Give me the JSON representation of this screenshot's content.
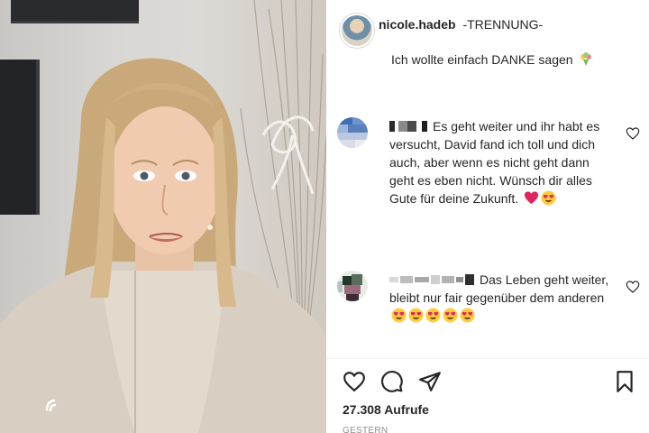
{
  "post": {
    "username": "nicole.hadeb",
    "caption_title": "-TRENNUNG-",
    "caption_body": "Ich wollte einfach DANKE sagen",
    "views": "27.308 Aufrufe",
    "timestamp": "GESTERN"
  },
  "comments": [
    {
      "text": "Es geht weiter und ihr habt es versucht, David fand ich toll und dich auch, aber wenn es nicht geht dann geht es eben nicht. Wünsch dir alles Gute für deine Zukunft.",
      "emojis": [
        "red-heart",
        "heart-eyes"
      ]
    },
    {
      "text": "Das Leben geht weiter, bleibt nur fair gegenüber dem anderen",
      "emojis": [
        "heart-eyes",
        "heart-eyes",
        "heart-eyes",
        "heart-eyes",
        "heart-eyes"
      ]
    }
  ],
  "actions": [
    "like-icon",
    "comment-icon",
    "share-icon",
    "save-icon"
  ],
  "colors": {
    "text": "#262626",
    "muted": "#8e8e8e",
    "heart_red": "#e0245e",
    "emoji_yellow": "#ffcc3e"
  }
}
